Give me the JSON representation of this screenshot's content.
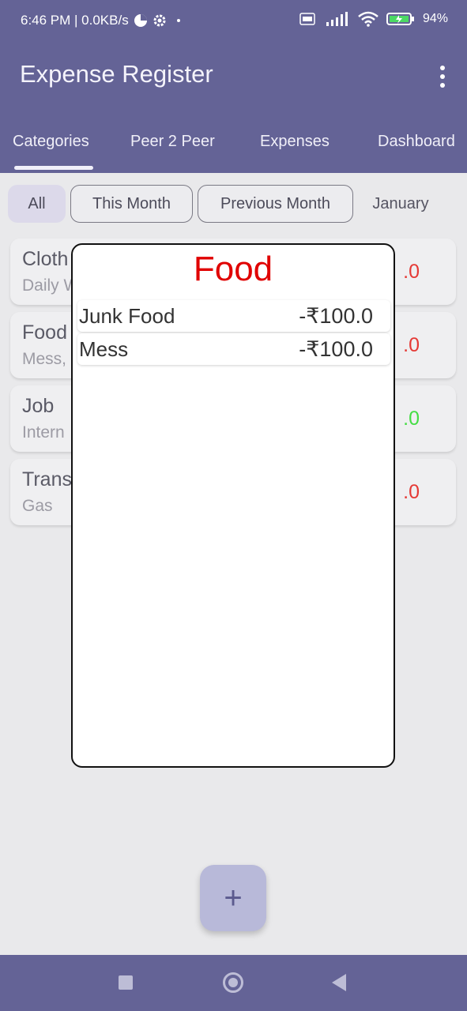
{
  "status_bar": {
    "time_speed": "6:46 PM | 0.0KB/s",
    "battery": "94%",
    "icons": [
      "data-saver-icon",
      "settings-gear-icon",
      "dot-icon",
      "volte-icon",
      "signal-icon",
      "wifi-icon",
      "battery-charging-icon"
    ]
  },
  "app_bar": {
    "title": "Expense Register"
  },
  "tabs": [
    {
      "label": "Categories"
    },
    {
      "label": "Peer 2 Peer"
    },
    {
      "label": "Expenses"
    },
    {
      "label": "Dashboard"
    }
  ],
  "filters": [
    {
      "label": "All"
    },
    {
      "label": "This Month"
    },
    {
      "label": "Previous Month"
    },
    {
      "label": "January"
    }
  ],
  "categories": [
    {
      "name": "Cloth",
      "sub": "Daily W",
      "amount": ".0"
    },
    {
      "name": "Food",
      "sub": "Mess,",
      "amount": ".0"
    },
    {
      "name": "Job",
      "sub": "Intern",
      "amount": ".0"
    },
    {
      "name": "Trans",
      "sub": "Gas",
      "amount": ".0"
    }
  ],
  "dialog": {
    "title": "Food",
    "items": [
      {
        "name": "Junk Food",
        "amount": "-₹100.0"
      },
      {
        "name": "Mess",
        "amount": "-₹100.0"
      }
    ]
  },
  "fab": {
    "label": "+"
  },
  "colors": {
    "primary": "#646396",
    "negative": "#e53935",
    "positive": "#44dd44",
    "dialog_title": "#e00000"
  }
}
